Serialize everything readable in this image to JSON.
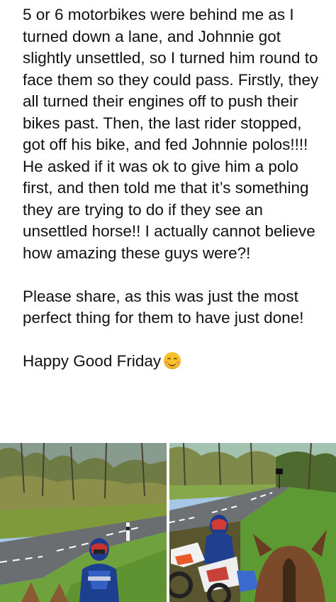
{
  "post": {
    "paragraphs": [
      "5 or 6 motorbikes were behind me as I turned down a lane, and Johnnie got slightly unsettled, so I turned him round to face them so they could pass. Firstly, they all turned their engines off to push their bikes past. Then, the last rider stopped, got off his bike, and fed Johnnie polos!!!! He asked if it was ok to give him a polo first, and then told me that it’s something they are trying to do if they see an unsettled horse!! I actually cannot believe how amazing these guys were?!",
      "Please share, as this was just the most perfect thing for them to have just done!",
      "Happy Good Friday"
    ],
    "emoji": "smiling-face-emoji"
  },
  "photos": [
    {
      "name": "photo-motorbike-rider-on-lane",
      "icon": "photo"
    },
    {
      "name": "photo-horse-and-motorbikes",
      "icon": "photo"
    }
  ]
}
